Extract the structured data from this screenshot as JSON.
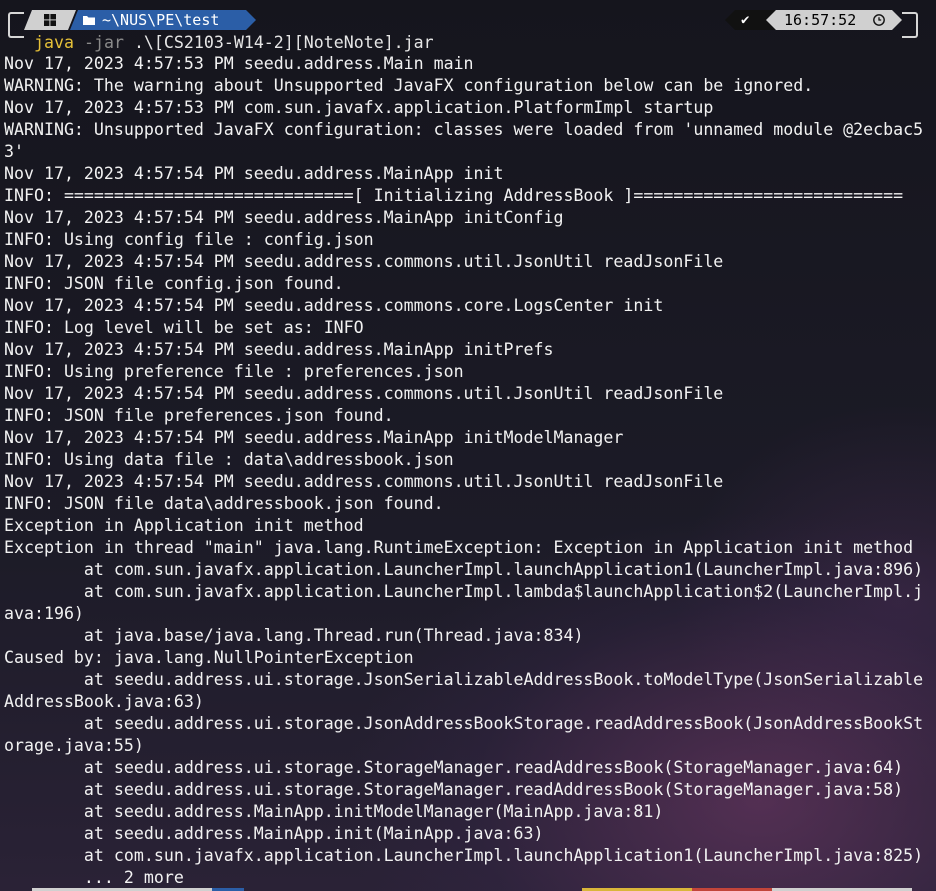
{
  "prompt": {
    "os_icon": "windows-icon",
    "folder_icon": "folder-icon",
    "path": "~\\NUS\\PE\\test",
    "status_icon": "checkmark-icon",
    "status": "✔",
    "time": "16:57:52",
    "clock_icon": "clock-icon",
    "colors": {
      "path_bg": "#2b5ea7",
      "segment_bg": "#d0d0d0",
      "status_bg": "#111111"
    }
  },
  "command": {
    "program": "java",
    "flag": "-jar",
    "argument": ".\\[CS2103-W14-2][NoteNote].jar",
    "colors": {
      "program": "#e5c038",
      "flag": "#8a8a8a"
    }
  },
  "output_lines": [
    "Nov 17, 2023 4:57:53 PM seedu.address.Main main",
    "WARNING: The warning about Unsupported JavaFX configuration below can be ignored.",
    "Nov 17, 2023 4:57:53 PM com.sun.javafx.application.PlatformImpl startup",
    "WARNING: Unsupported JavaFX configuration: classes were loaded from 'unnamed module @2ecbac5",
    "3'",
    "Nov 17, 2023 4:57:54 PM seedu.address.MainApp init",
    "INFO: =============================[ Initializing AddressBook ]===========================",
    "Nov 17, 2023 4:57:54 PM seedu.address.MainApp initConfig",
    "INFO: Using config file : config.json",
    "Nov 17, 2023 4:57:54 PM seedu.address.commons.util.JsonUtil readJsonFile",
    "INFO: JSON file config.json found.",
    "Nov 17, 2023 4:57:54 PM seedu.address.commons.core.LogsCenter init",
    "INFO: Log level will be set as: INFO",
    "Nov 17, 2023 4:57:54 PM seedu.address.MainApp initPrefs",
    "INFO: Using preference file : preferences.json",
    "Nov 17, 2023 4:57:54 PM seedu.address.commons.util.JsonUtil readJsonFile",
    "INFO: JSON file preferences.json found.",
    "Nov 17, 2023 4:57:54 PM seedu.address.MainApp initModelManager",
    "INFO: Using data file : data\\addressbook.json",
    "Nov 17, 2023 4:57:54 PM seedu.address.commons.util.JsonUtil readJsonFile",
    "INFO: JSON file data\\addressbook.json found.",
    "Exception in Application init method",
    "Exception in thread \"main\" java.lang.RuntimeException: Exception in Application init method",
    "        at com.sun.javafx.application.LauncherImpl.launchApplication1(LauncherImpl.java:896)",
    "        at com.sun.javafx.application.LauncherImpl.lambda$launchApplication$2(LauncherImpl.j",
    "ava:196)",
    "        at java.base/java.lang.Thread.run(Thread.java:834)",
    "Caused by: java.lang.NullPointerException",
    "        at seedu.address.ui.storage.JsonSerializableAddressBook.toModelType(JsonSerializable",
    "AddressBook.java:63)",
    "        at seedu.address.ui.storage.JsonAddressBookStorage.readAddressBook(JsonAddressBookSt",
    "orage.java:55)",
    "        at seedu.address.ui.storage.StorageManager.readAddressBook(StorageManager.java:64)",
    "        at seedu.address.ui.storage.StorageManager.readAddressBook(StorageManager.java:58)",
    "        at seedu.address.MainApp.initModelManager(MainApp.java:81)",
    "        at seedu.address.MainApp.init(MainApp.java:63)",
    "        at com.sun.javafx.application.LauncherImpl.launchApplication1(LauncherImpl.java:825)",
    "        ... 2 more"
  ],
  "colors": {
    "background": "#1b1a26",
    "text": "#f2f2f2"
  }
}
